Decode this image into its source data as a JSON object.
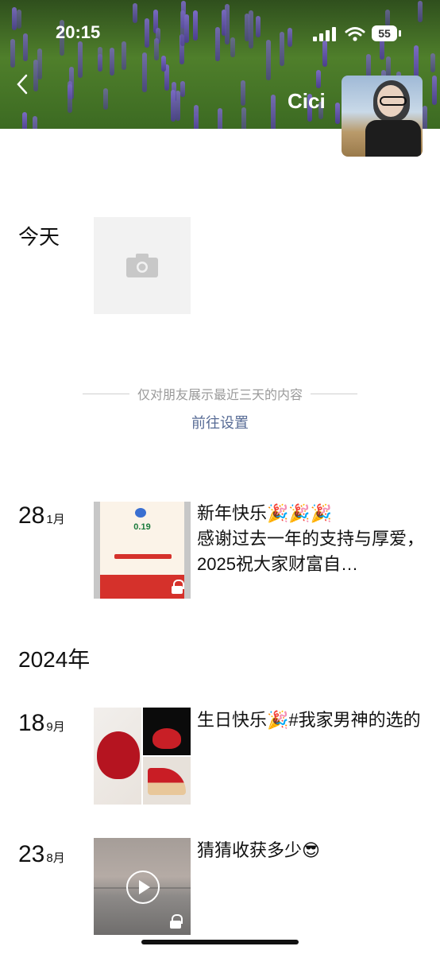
{
  "status": {
    "time": "20:15",
    "battery": "55"
  },
  "profile": {
    "name": "Cici"
  },
  "today": {
    "label": "今天"
  },
  "privacy": {
    "note": "仅对朋友展示最近三天的内容",
    "link": "前往设置"
  },
  "posts": [
    {
      "day": "28",
      "month": "1月",
      "text": "新年快乐🎉🎉🎉\n感谢过去一年的支持与厚爱，2025祝大家财富自…",
      "thumb": {
        "amount": "0.19"
      }
    },
    {
      "day": "18",
      "month": "9月",
      "text": "生日快乐🎉#我家男神的选的"
    },
    {
      "day": "23",
      "month": "8月",
      "text": "猜猜收获多少😎"
    }
  ],
  "year_divider": "2024年",
  "colors": {
    "link": "#576b95",
    "muted": "#9a9a9a",
    "placeholder": "#f2f2f2"
  }
}
